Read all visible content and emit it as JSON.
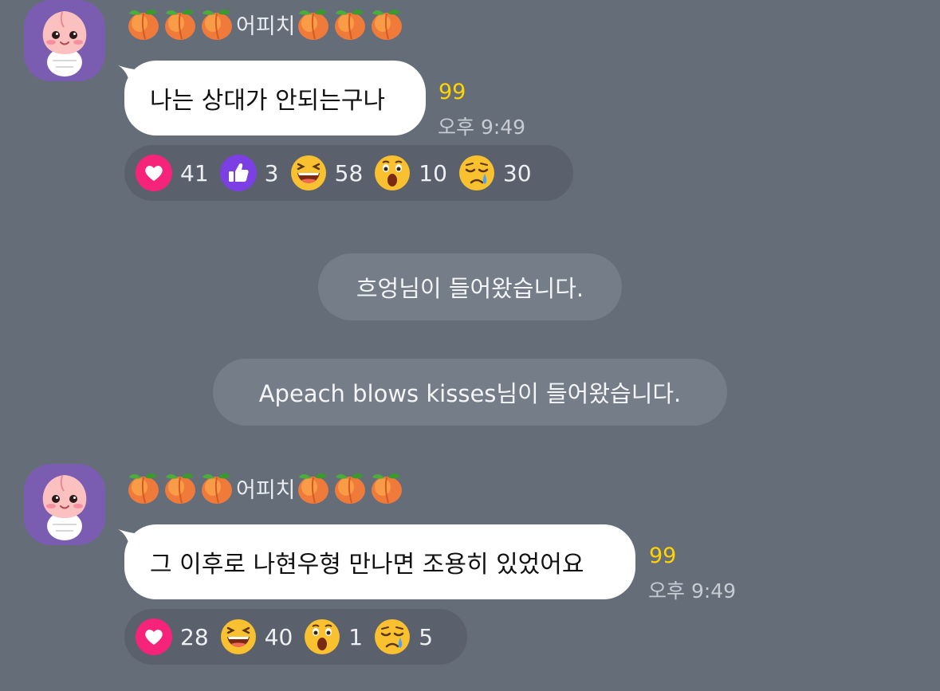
{
  "messages": [
    {
      "sender": "어피치",
      "text": "나는 상대가 안되는구나",
      "unread": "99",
      "time": "오후 9:49",
      "reactions": [
        {
          "icon": "heart-icon",
          "count": "41"
        },
        {
          "icon": "thumbs-up-icon",
          "count": "3"
        },
        {
          "icon": "laughing-face-icon",
          "count": "58"
        },
        {
          "icon": "surprised-face-icon",
          "count": "10"
        },
        {
          "icon": "sad-face-icon",
          "count": "30"
        }
      ]
    },
    {
      "sender": "어피치",
      "text": "그 이후로 나현우형 만나면 조용히 있었어요",
      "unread": "99",
      "time": "오후 9:49",
      "reactions": [
        {
          "icon": "heart-icon",
          "count": "28"
        },
        {
          "icon": "laughing-face-icon",
          "count": "40"
        },
        {
          "icon": "surprised-face-icon",
          "count": "1"
        },
        {
          "icon": "sad-face-icon",
          "count": "5"
        }
      ]
    }
  ],
  "system_messages": [
    "흐엉님이 들어왔습니다.",
    "Apeach blows kisses님이 들어왔습니다."
  ],
  "colors": {
    "background": "#656d79",
    "bubble": "#ffffff",
    "unread": "#ffd400",
    "avatar_bg": "#7a5db0",
    "heart": "#f5237a",
    "thumbs_up": "#7b3fe4"
  },
  "sender_decoration": "peach-emoji ×3 before and after name"
}
